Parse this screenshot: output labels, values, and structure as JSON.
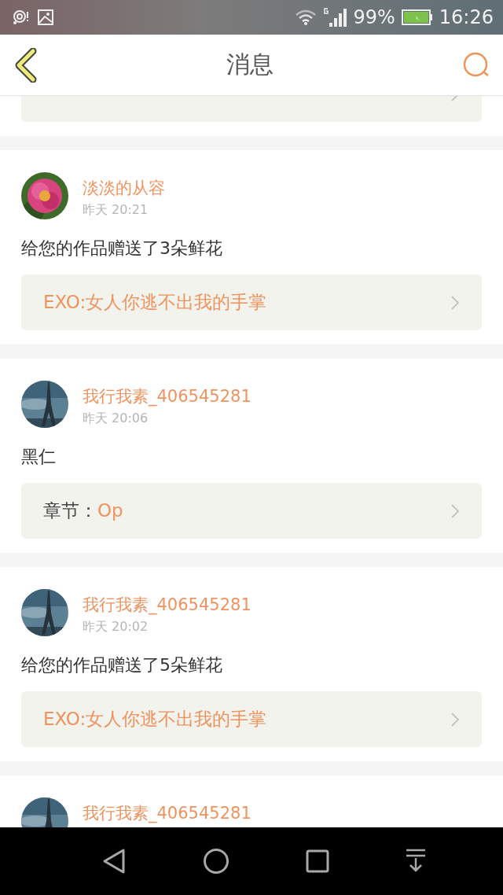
{
  "status_bar": {
    "battery": "99%",
    "time": "16:26"
  },
  "header": {
    "title": "消息"
  },
  "messages": [
    {
      "link": {
        "kind": "work"
      }
    },
    {
      "user": "淡淡的从容",
      "time": "昨天 20:21",
      "text": "给您的作品赠送了3朵鲜花",
      "link": {
        "kind": "work",
        "text": "EXO:女人你逃不出我的手掌"
      }
    },
    {
      "user": "我行我素_406545281",
      "time": "昨天 20:06",
      "text": "黑仁",
      "link": {
        "kind": "chapter",
        "label": "章节：",
        "text": "Op"
      }
    },
    {
      "user": "我行我素_406545281",
      "time": "昨天 20:02",
      "text": "给您的作品赠送了5朵鲜花",
      "link": {
        "kind": "work",
        "text": "EXO:女人你逃不出我的手掌"
      }
    },
    {
      "user": "我行我素_406545281"
    }
  ]
}
